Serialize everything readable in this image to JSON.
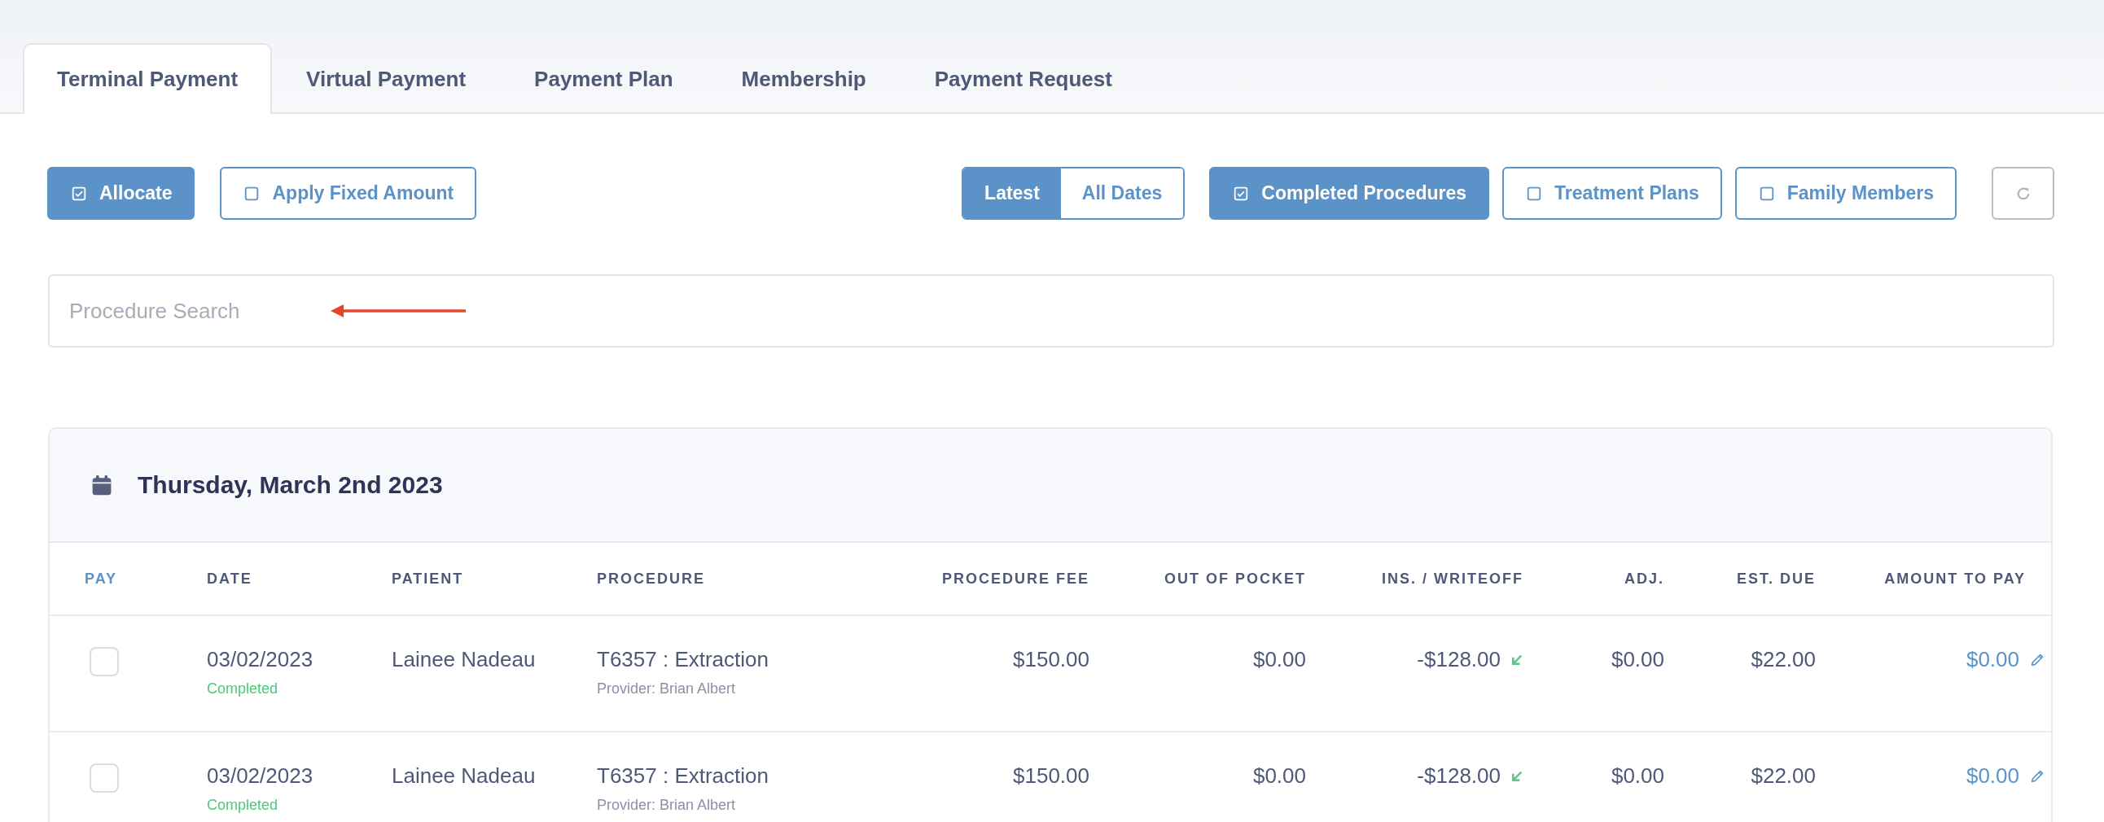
{
  "tabs": [
    {
      "label": "Terminal Payment",
      "selected": true
    },
    {
      "label": "Virtual Payment",
      "selected": false
    },
    {
      "label": "Payment Plan",
      "selected": false
    },
    {
      "label": "Membership",
      "selected": false
    },
    {
      "label": "Payment Request",
      "selected": false
    }
  ],
  "options": [
    {
      "label": "Allocate",
      "checked": true
    },
    {
      "label": "Apply Fixed Amount",
      "checked": false
    }
  ],
  "date_range": [
    {
      "label": "Latest",
      "selected": true
    },
    {
      "label": "All Dates",
      "selected": false
    }
  ],
  "filters": [
    {
      "label": "Completed Procedures",
      "checked": true
    },
    {
      "label": "Treatment Plans",
      "checked": false
    },
    {
      "label": "Family Members",
      "checked": false
    }
  ],
  "refresh": {
    "disabled": true
  },
  "search": {
    "placeholder": "Procedure Search"
  },
  "group": {
    "title": "Thursday, March 2nd 2023"
  },
  "table": {
    "columns": [
      "PAY",
      "DATE",
      "PATIENT",
      "PROCEDURE",
      "PROCEDURE FEE",
      "OUT OF POCKET",
      "INS. / WRITEOFF",
      "ADJ.",
      "EST. DUE",
      "AMOUNT TO PAY"
    ],
    "rows": [
      {
        "checked": false,
        "date": "03/02/2023",
        "status": "Completed",
        "patient": "Lainee Nadeau",
        "procedure": "T6357 : Extraction",
        "provider": "Provider: Brian Albert",
        "fee": "$150.00",
        "out_of_pocket": "$0.00",
        "writeoff": "-$128.00",
        "adj": "$0.00",
        "est_due": "$22.00",
        "amount": "$0.00"
      },
      {
        "checked": false,
        "date": "03/02/2023",
        "status": "Completed",
        "patient": "Lainee Nadeau",
        "procedure": "T6357 : Extraction",
        "provider": "Provider: Brian Albert",
        "fee": "$150.00",
        "out_of_pocket": "$0.00",
        "writeoff": "-$128.00",
        "adj": "$0.00",
        "est_due": "$22.00",
        "amount": "$0.00"
      }
    ]
  }
}
